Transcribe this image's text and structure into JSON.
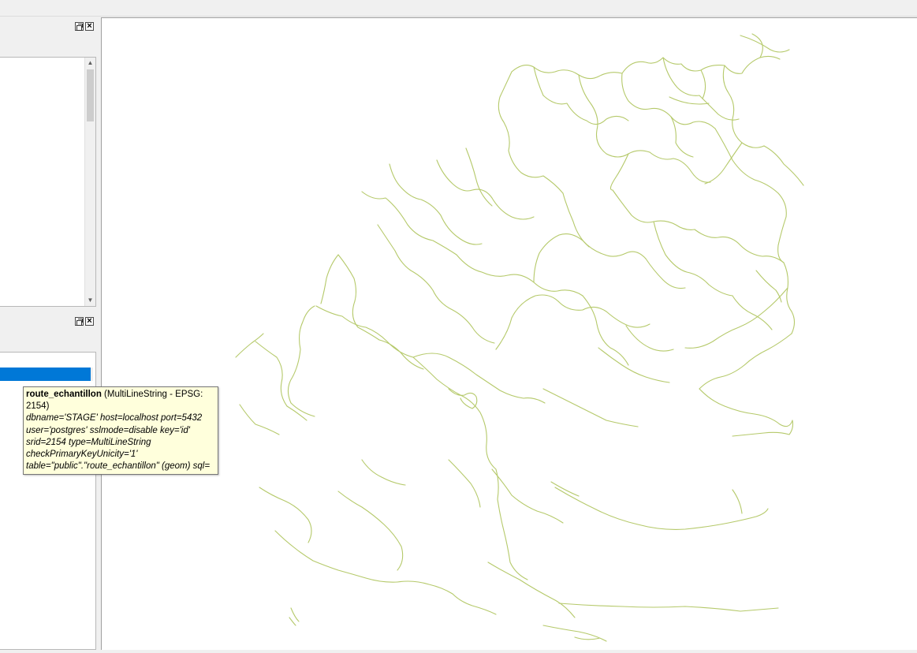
{
  "tooltip": {
    "layer_name": "route_echantillon",
    "layer_type": " (MultiLineString - EPSG:",
    "layer_type_cont": "2154)",
    "source_lines": [
      "dbname='STAGE' host=localhost port=5432",
      "user='postgres' sslmode=disable key='id'",
      "srid=2154 type=MultiLineString",
      "checkPrimaryKeyUnicity='1'",
      "table=\"public\".\"route_echantillon\" (geom) sql="
    ]
  },
  "icons": {
    "float": "float-dock-icon",
    "close": "close-dock-icon",
    "scroll_up": "scroll-up-arrow-icon",
    "scroll_down": "scroll-down-arrow-icon"
  },
  "colors": {
    "line_color": "#b5c96a",
    "selection": "#0078d7",
    "tooltip_bg": "#ffffdc"
  }
}
